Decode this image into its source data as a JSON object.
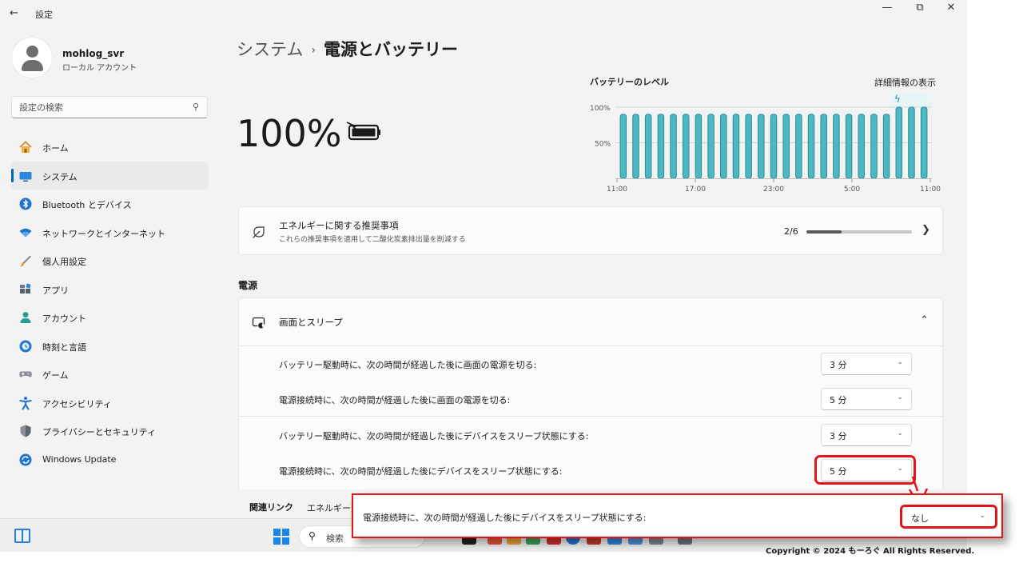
{
  "window": {
    "back_glyph": "←",
    "title": "設定",
    "minimize_glyph": "—",
    "restore_glyph": "⧉",
    "close_glyph": "✕"
  },
  "profile": {
    "name": "mohlog_svr",
    "account_type": "ローカル アカウント"
  },
  "search": {
    "placeholder": "設定の検索",
    "icon": "search-icon"
  },
  "sidebar": {
    "items": [
      {
        "label": "ホーム",
        "icon": "home-icon",
        "active": false
      },
      {
        "label": "システム",
        "icon": "system-icon",
        "active": true
      },
      {
        "label": "Bluetooth とデバイス",
        "icon": "bluetooth-icon",
        "active": false
      },
      {
        "label": "ネットワークとインターネット",
        "icon": "network-icon",
        "active": false
      },
      {
        "label": "個人用設定",
        "icon": "personalization-icon",
        "active": false
      },
      {
        "label": "アプリ",
        "icon": "apps-icon",
        "active": false
      },
      {
        "label": "アカウント",
        "icon": "account-icon",
        "active": false
      },
      {
        "label": "時刻と言語",
        "icon": "time-language-icon",
        "active": false
      },
      {
        "label": "ゲーム",
        "icon": "gaming-icon",
        "active": false
      },
      {
        "label": "アクセシビリティ",
        "icon": "accessibility-icon",
        "active": false
      },
      {
        "label": "プライバシーとセキュリティ",
        "icon": "privacy-shield-icon",
        "active": false
      },
      {
        "label": "Windows Update",
        "icon": "windows-update-icon",
        "active": false
      }
    ]
  },
  "breadcrumb": {
    "parent": "システム",
    "separator": "›",
    "current": "電源とバッテリー"
  },
  "battery": {
    "percent": "100%",
    "level": 1.0
  },
  "battery_chart": {
    "title": "バッテリーのレベル",
    "details_link": "詳細情報の表示",
    "charging_glyph": "ϟ"
  },
  "chart_data": {
    "type": "bar",
    "title": "バッテリーのレベル",
    "ytick_labels": [
      "100%",
      "50%"
    ],
    "ylim": [
      0,
      100
    ],
    "xtick_labels": [
      "11:00",
      "17:00",
      "23:00",
      "5:00",
      "11:00"
    ],
    "values": [
      90,
      90,
      90,
      90,
      90,
      90,
      90,
      90,
      90,
      90,
      90,
      90,
      90,
      90,
      90,
      90,
      90,
      90,
      90,
      90,
      90,
      90,
      100,
      100,
      100
    ],
    "charging_from_index": 22,
    "bar_color": "#4cb8c4",
    "bar_stroke": "#2a8a97",
    "grid": true
  },
  "recommendations": {
    "title": "エネルギーに関する推奨事項",
    "subtitle": "これらの推奨事項を適用して二酸化炭素排出量を削減する",
    "count": "2/6",
    "progress": 0.33
  },
  "power_section": {
    "title": "電源",
    "screen_sleep": {
      "label": "画面とスリープ",
      "rows": [
        {
          "label": "バッテリー駆動時に、次の時間が経過した後に画面の電源を切る:",
          "value": "3 分"
        },
        {
          "label": "電源接続時に、次の時間が経過した後に画面の電源を切る:",
          "value": "5 分"
        },
        {
          "label": "バッテリー駆動時に、次の時間が経過した後にデバイスをスリープ状態にする:",
          "value": "3 分"
        },
        {
          "label": "電源接続時に、次の時間が経過した後にデバイスをスリープ状態にする:",
          "value": "5 分"
        }
      ]
    }
  },
  "related": {
    "title": "関連リンク",
    "link": "エネルギー効"
  },
  "taskbar": {
    "search_label": "検索"
  },
  "callout": {
    "label": "電源接続時に、次の時間が経過した後にデバイスをスリープ状態にする:",
    "value": "なし"
  },
  "chevron_down_glyph": "⌄",
  "watermark": "Copyright © 2024 もーろぐ All Rights Reserved.",
  "colors": {
    "accent": "#0067c0",
    "highlight": "#e3141a",
    "chart_bar": "#4cb8c4"
  }
}
